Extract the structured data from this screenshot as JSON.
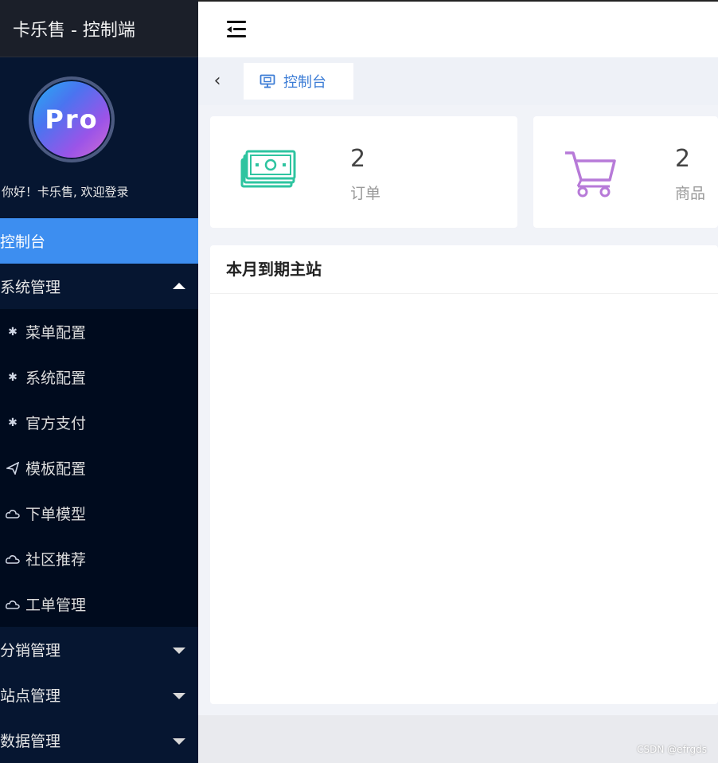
{
  "sidebar": {
    "brand": "卡乐售 - 控制端",
    "avatar_text": "Pro",
    "welcome": "你好！卡乐售, 欢迎登录",
    "items": [
      {
        "label": "控制台",
        "active": true
      },
      {
        "label": "系统管理",
        "expanded": true
      },
      {
        "label": "分销管理",
        "expanded": false
      },
      {
        "label": "站点管理",
        "expanded": false
      },
      {
        "label": "数据管理",
        "expanded": false
      }
    ],
    "submenu": [
      {
        "label": "菜单配置",
        "icon": "gear-icon"
      },
      {
        "label": "系统配置",
        "icon": "gear-icon"
      },
      {
        "label": "官方支付",
        "icon": "gear-icon"
      },
      {
        "label": "模板配置",
        "icon": "send-icon"
      },
      {
        "label": "下单模型",
        "icon": "cloud-icon"
      },
      {
        "label": "社区推荐",
        "icon": "cloud-icon"
      },
      {
        "label": "工单管理",
        "icon": "cloud-icon"
      }
    ]
  },
  "tabs": [
    {
      "label": "控制台",
      "icon": "monitor-icon"
    }
  ],
  "stats": [
    {
      "value": "2",
      "label": "订单",
      "icon": "money-icon",
      "color": "#2ec4a0"
    },
    {
      "value": "2",
      "label": "商品",
      "icon": "cart-icon",
      "color": "#b77ad8"
    }
  ],
  "panel": {
    "title": "本月到期主站"
  },
  "watermark": "CSDN @efrgds",
  "colors": {
    "sidebar_bg": "#061631",
    "active": "#3d8ef0",
    "brand_bg": "#1b1f29"
  }
}
